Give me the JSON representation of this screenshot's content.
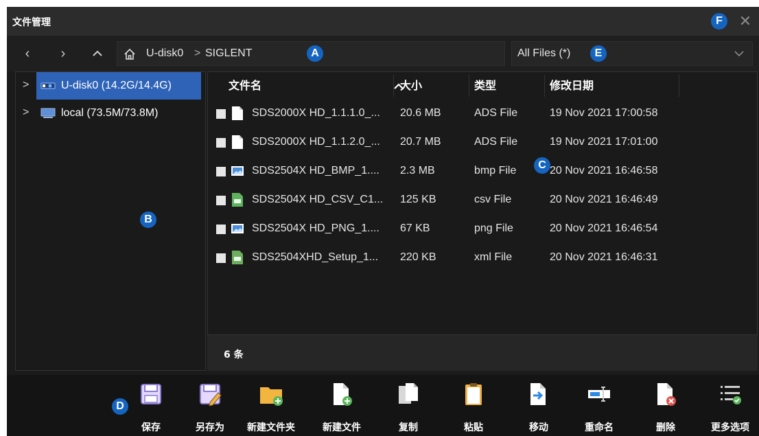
{
  "window": {
    "title": "文件管理",
    "close_glyph": "✕"
  },
  "nav": {
    "back": "‹",
    "forward": "›",
    "up": "^",
    "path": [
      "U-disk0",
      "SIGLENT"
    ],
    "separator": ">",
    "filter": "All Files (*)"
  },
  "markers": {
    "a": "A",
    "b": "B",
    "c": "C",
    "d": "D",
    "e": "E",
    "f": "F"
  },
  "tree": [
    {
      "label": "U-disk0  (14.2G/14.4G)",
      "icon": "usb-drive-icon",
      "selected": true
    },
    {
      "label": "local  (73.5M/73.8M)",
      "icon": "computer-icon",
      "selected": false
    }
  ],
  "filelist": {
    "columns": {
      "name": "文件名",
      "size": "大小",
      "type": "类型",
      "date": "修改日期"
    },
    "rows": [
      {
        "name": "SDS2000X HD_1.1.1.0_...",
        "size": "20.6 MB",
        "type": "ADS File",
        "date": "19 Nov 2021 17:00:58",
        "icon": "file-icon"
      },
      {
        "name": "SDS2000X HD_1.1.2.0_...",
        "size": "20.7 MB",
        "type": "ADS File",
        "date": "19 Nov 2021 17:01:00",
        "icon": "file-icon"
      },
      {
        "name": "SDS2504X HD_BMP_1....",
        "size": "2.3 MB",
        "type": "bmp File",
        "date": "20 Nov 2021 16:46:58",
        "icon": "image-file-icon"
      },
      {
        "name": "SDS2504X HD_CSV_C1...",
        "size": "125 KB",
        "type": "csv File",
        "date": "20 Nov 2021 16:46:49",
        "icon": "csv-file-icon"
      },
      {
        "name": "SDS2504X HD_PNG_1....",
        "size": "67 KB",
        "type": "png File",
        "date": "20 Nov 2021 16:46:54",
        "icon": "image-file-icon"
      },
      {
        "name": "SDS2504XHD_Setup_1...",
        "size": "220 KB",
        "type": "xml File",
        "date": "20 Nov 2021 16:46:31",
        "icon": "xml-file-icon"
      }
    ],
    "count": "6 条"
  },
  "toolbar": [
    {
      "label": "保存",
      "icon": "save-icon"
    },
    {
      "label": "另存为",
      "icon": "save-as-icon"
    },
    {
      "label": "新建文件夹",
      "icon": "new-folder-icon"
    },
    {
      "label": "新建文件",
      "icon": "new-file-icon"
    },
    {
      "label": "复制",
      "icon": "copy-icon"
    },
    {
      "label": "粘贴",
      "icon": "paste-icon"
    },
    {
      "label": "移动",
      "icon": "move-icon"
    },
    {
      "label": "重命名",
      "icon": "rename-icon"
    },
    {
      "label": "删除",
      "icon": "delete-icon"
    },
    {
      "label": "更多选项",
      "icon": "more-options-icon"
    }
  ],
  "colors": {
    "selected": "#2e63b8",
    "marker": "#1565c0",
    "background": "#1b1b1b"
  }
}
